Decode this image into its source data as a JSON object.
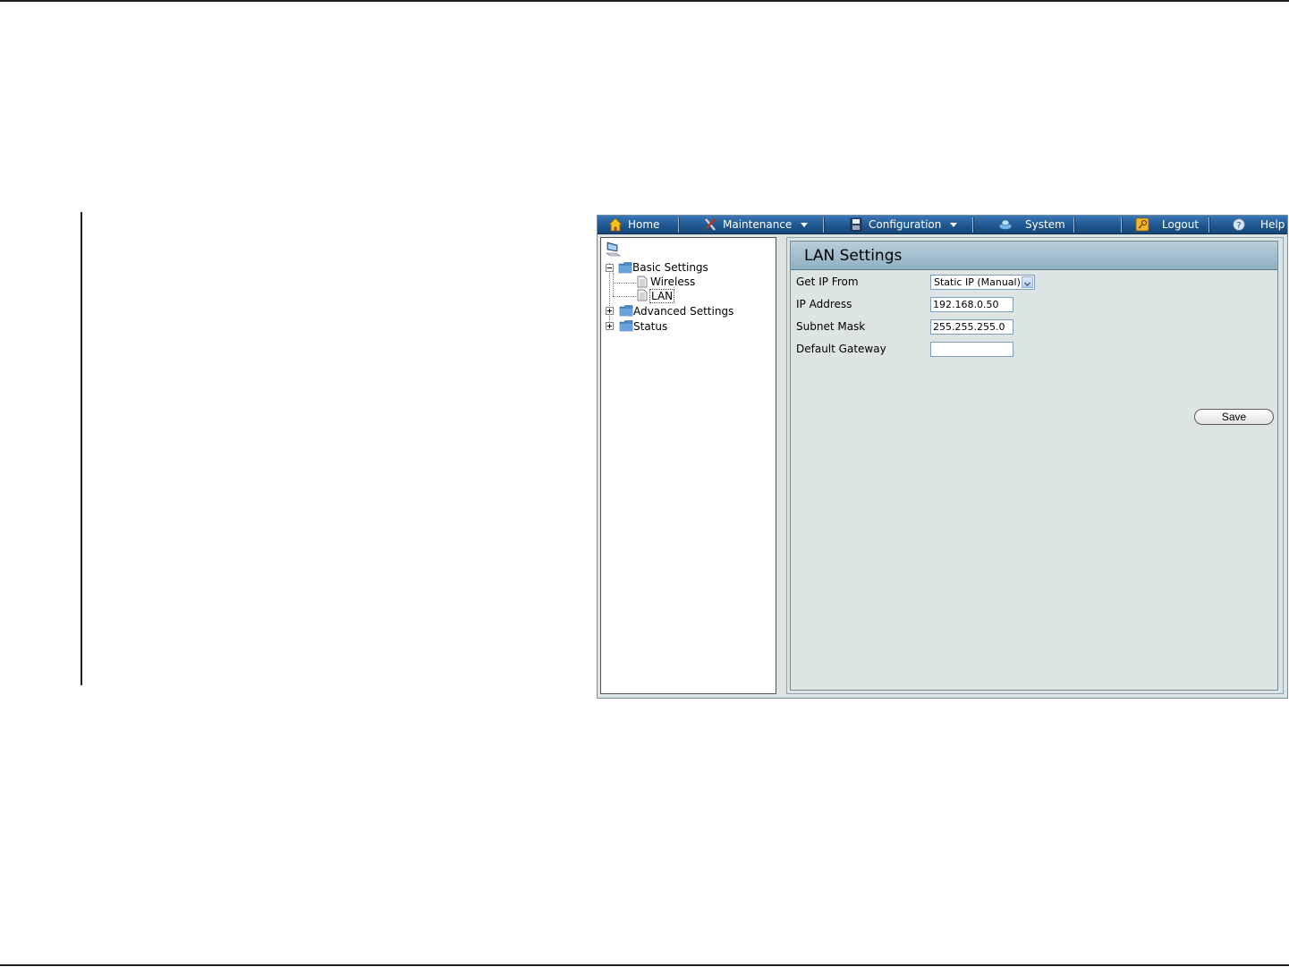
{
  "menubar": {
    "home": {
      "label": "Home",
      "icon": "home-icon"
    },
    "maintenance": {
      "label": "Maintenance",
      "icon": "tools-icon"
    },
    "configuration": {
      "label": "Configuration",
      "icon": "floppy-disk-icon"
    },
    "system": {
      "label": "System",
      "icon": "system-icon"
    },
    "logout": {
      "label": "Logout",
      "icon": "key-icon"
    },
    "help": {
      "label": "Help",
      "icon": "help-icon"
    }
  },
  "tree": {
    "basic_settings": "Basic Settings",
    "wireless": "Wireless",
    "lan": "LAN",
    "advanced_settings": "Advanced Settings",
    "status": "Status"
  },
  "panel": {
    "title": "LAN Settings",
    "fields": {
      "get_ip_from_label": "Get IP From",
      "get_ip_from_value": "Static IP (Manual)",
      "ip_address_label": "IP Address",
      "ip_address_value": "192.168.0.50",
      "subnet_mask_label": "Subnet Mask",
      "subnet_mask_value": "255.255.255.0",
      "default_gateway_label": "Default Gateway",
      "default_gateway_value": ""
    },
    "save_label": "Save"
  },
  "colors": {
    "menubar": "#1f568f",
    "panel_bg": "#dce4e4",
    "header": "#9fbccb"
  }
}
